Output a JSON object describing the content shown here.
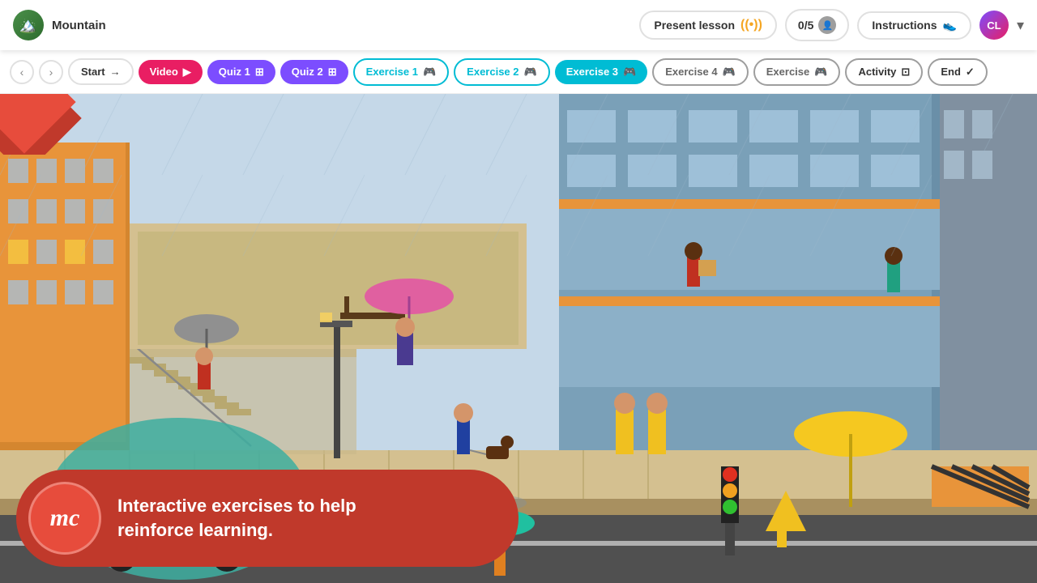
{
  "topbar": {
    "mountain_label": "Mountain",
    "present_lesson_label": "Present lesson",
    "score": "0/5",
    "instructions_label": "Instructions",
    "user_initials": "CL",
    "chevron": "▾"
  },
  "navbar": {
    "prev_arrow": "‹",
    "next_arrow": "›",
    "buttons": [
      {
        "id": "start",
        "label": "Start",
        "icon": "→",
        "style": "start"
      },
      {
        "id": "video",
        "label": "Video",
        "icon": "▶",
        "style": "video"
      },
      {
        "id": "quiz1",
        "label": "Quiz 1",
        "icon": "⊞",
        "style": "quiz1"
      },
      {
        "id": "quiz2",
        "label": "Quiz 2",
        "icon": "⊞",
        "style": "quiz2"
      },
      {
        "id": "ex1",
        "label": "Exercise 1",
        "icon": "🎮",
        "style": "ex1"
      },
      {
        "id": "ex2",
        "label": "Exercise 2",
        "icon": "🎮",
        "style": "ex2"
      },
      {
        "id": "ex3",
        "label": "Exercise 3",
        "icon": "🎮",
        "style": "ex3"
      },
      {
        "id": "ex4",
        "label": "Exercise 4",
        "icon": "🎮",
        "style": "ex4"
      },
      {
        "id": "ex5",
        "label": "Exercise",
        "icon": "🎮",
        "style": "ex5"
      },
      {
        "id": "activity",
        "label": "Activity",
        "icon": "⊡",
        "style": "activity"
      },
      {
        "id": "end",
        "label": "End",
        "icon": "✓",
        "style": "end"
      }
    ]
  },
  "overlay": {
    "mc_logo": "mc",
    "description_line1": "Interactive exercises to help",
    "description_line2": "reinforce learning."
  }
}
